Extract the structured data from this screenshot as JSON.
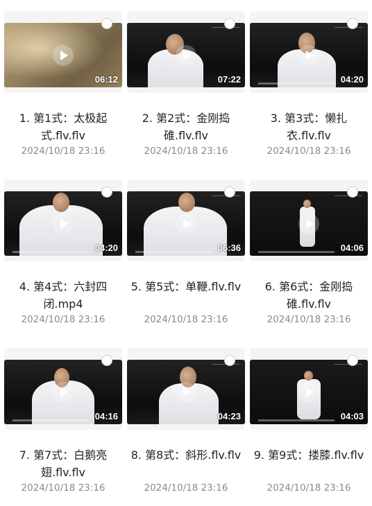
{
  "videos": [
    {
      "title": "1. 第1式：太极起式.flv.flv",
      "date": "2024/10/18 23:16",
      "duration": "06:12"
    },
    {
      "title": "2. 第2式：金刚捣碓.flv.flv",
      "date": "2024/10/18 23:16",
      "duration": "07:22"
    },
    {
      "title": "3. 第3式：懒扎衣.flv.flv",
      "date": "2024/10/18 23:16",
      "duration": "04:20"
    },
    {
      "title": "4. 第4式：六封四闭.mp4",
      "date": "2024/10/18 23:16",
      "duration": "04:20"
    },
    {
      "title": "5. 第5式：单鞭.flv.flv",
      "date": "2024/10/18 23:16",
      "duration": "06:36"
    },
    {
      "title": "6. 第6式：金刚捣碓.flv.flv",
      "date": "2024/10/18 23:16",
      "duration": "04:06"
    },
    {
      "title": "7. 第7式：白鹅亮翅.flv.flv",
      "date": "2024/10/18 23:16",
      "duration": "04:16"
    },
    {
      "title": "8. 第8式：斜形.flv.flv",
      "date": "2024/10/18 23:16",
      "duration": "04:23"
    },
    {
      "title": "9. 第9式：搂膝.flv.flv",
      "date": "2024/10/18 23:16",
      "duration": "04:03"
    }
  ],
  "icons": {
    "play": "play-icon",
    "select": "select-circle-icon"
  }
}
